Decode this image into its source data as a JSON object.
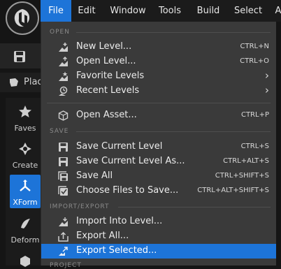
{
  "menubar": {
    "items": [
      {
        "label": "File",
        "active": true
      },
      {
        "label": "Edit"
      },
      {
        "label": "Window"
      },
      {
        "label": "Tools"
      },
      {
        "label": "Build"
      },
      {
        "label": "Select"
      },
      {
        "label": "A"
      }
    ]
  },
  "left_panel": {
    "place_tab_label": "Plac",
    "modes": [
      {
        "label": "Faves",
        "icon": "star-icon"
      },
      {
        "label": "Create",
        "icon": "create-icon"
      },
      {
        "label": "XForm",
        "icon": "xform-icon",
        "active": true
      },
      {
        "label": "Deform",
        "icon": "deform-icon"
      }
    ]
  },
  "file_menu": {
    "sections": [
      {
        "label": "OPEN"
      },
      {
        "label": "SAVE"
      },
      {
        "label": "IMPORT/EXPORT"
      },
      {
        "label": "PROJECT"
      }
    ],
    "items": [
      {
        "label": "New Level...",
        "shortcut": "CTRL+N",
        "icon": "new-level-icon"
      },
      {
        "label": "Open Level...",
        "shortcut": "CTRL+O",
        "icon": "open-level-icon"
      },
      {
        "label": "Favorite Levels",
        "shortcut": "",
        "icon": "favorite-levels-icon",
        "submenu": "›"
      },
      {
        "label": "Recent Levels",
        "shortcut": "",
        "icon": "recent-levels-icon",
        "submenu": "›"
      },
      {
        "label": "Open Asset...",
        "shortcut": "CTRL+P",
        "icon": "open-asset-icon"
      },
      {
        "label": "Save Current Level",
        "shortcut": "CTRL+S",
        "icon": "save-icon"
      },
      {
        "label": "Save Current Level As...",
        "shortcut": "CTRL+ALT+S",
        "icon": "save-as-icon"
      },
      {
        "label": "Save All",
        "shortcut": "CTRL+SHIFT+S",
        "icon": "save-all-icon"
      },
      {
        "label": "Choose Files to Save...",
        "shortcut": "CTRL+ALT+SHIFT+S",
        "icon": "choose-files-icon"
      },
      {
        "label": "Import Into Level...",
        "shortcut": "",
        "icon": "import-icon"
      },
      {
        "label": "Export All...",
        "shortcut": "",
        "icon": "export-all-icon"
      },
      {
        "label": "Export Selected...",
        "shortcut": "",
        "icon": "export-selected-icon",
        "highlighted": true
      }
    ]
  },
  "colors": {
    "accent": "#1d74d8",
    "menu_bg": "#3a3a3a",
    "editor_bg": "#151515"
  }
}
